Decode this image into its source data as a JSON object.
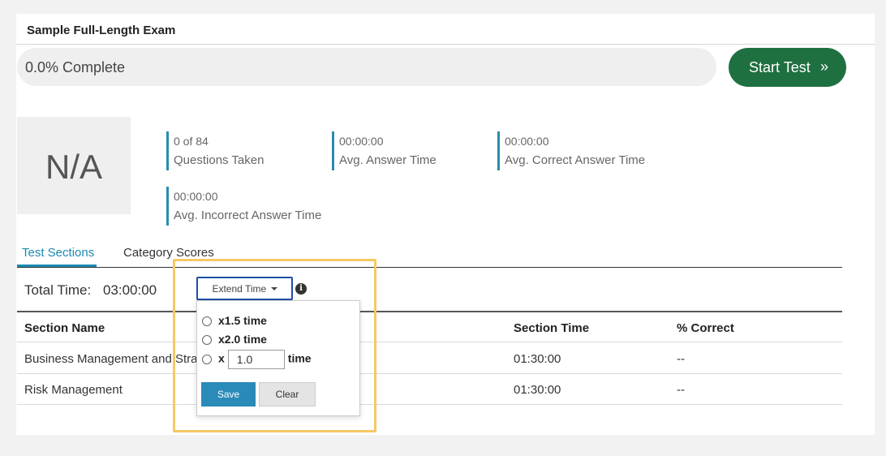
{
  "exam": {
    "title": "Sample Full-Length Exam"
  },
  "progress": {
    "label": "0.0% Complete",
    "fraction": 0.0
  },
  "start_button": {
    "label": "Start Test",
    "icon": "double-chevron-right-icon",
    "chevron": "»"
  },
  "score": {
    "value": "N/A"
  },
  "stats": [
    {
      "value": "0 of 84",
      "label": "Questions Taken"
    },
    {
      "value": "00:00:00",
      "label": "Avg. Answer Time"
    },
    {
      "value": "00:00:00",
      "label": "Avg. Correct Answer Time"
    },
    {
      "value": "00:00:00",
      "label": "Avg. Incorrect Answer Time"
    }
  ],
  "tabs": [
    {
      "label": "Test Sections",
      "active": true
    },
    {
      "label": "Category Scores",
      "active": false
    }
  ],
  "total_time": {
    "label": "Total Time:",
    "value": "03:00:00"
  },
  "extend_time": {
    "button_label": "Extend Time",
    "options": [
      {
        "label": "x1.5 time"
      },
      {
        "label": "x2.0 time"
      }
    ],
    "custom": {
      "prefix": "x",
      "value": "1.0",
      "suffix": "time"
    },
    "save_label": "Save",
    "clear_label": "Clear"
  },
  "info_icon": {
    "glyph": "i"
  },
  "table": {
    "headers": [
      "Section Name",
      "Section Time",
      "% Correct"
    ],
    "rows": [
      {
        "name": "Business Management and Strategy",
        "time": "01:30:00",
        "correct": "--"
      },
      {
        "name": "Risk Management",
        "time": "01:30:00",
        "correct": "--"
      }
    ]
  },
  "colors": {
    "accent": "#1a8ab2",
    "start_button": "#1f7040",
    "highlight": "#f5c964"
  }
}
